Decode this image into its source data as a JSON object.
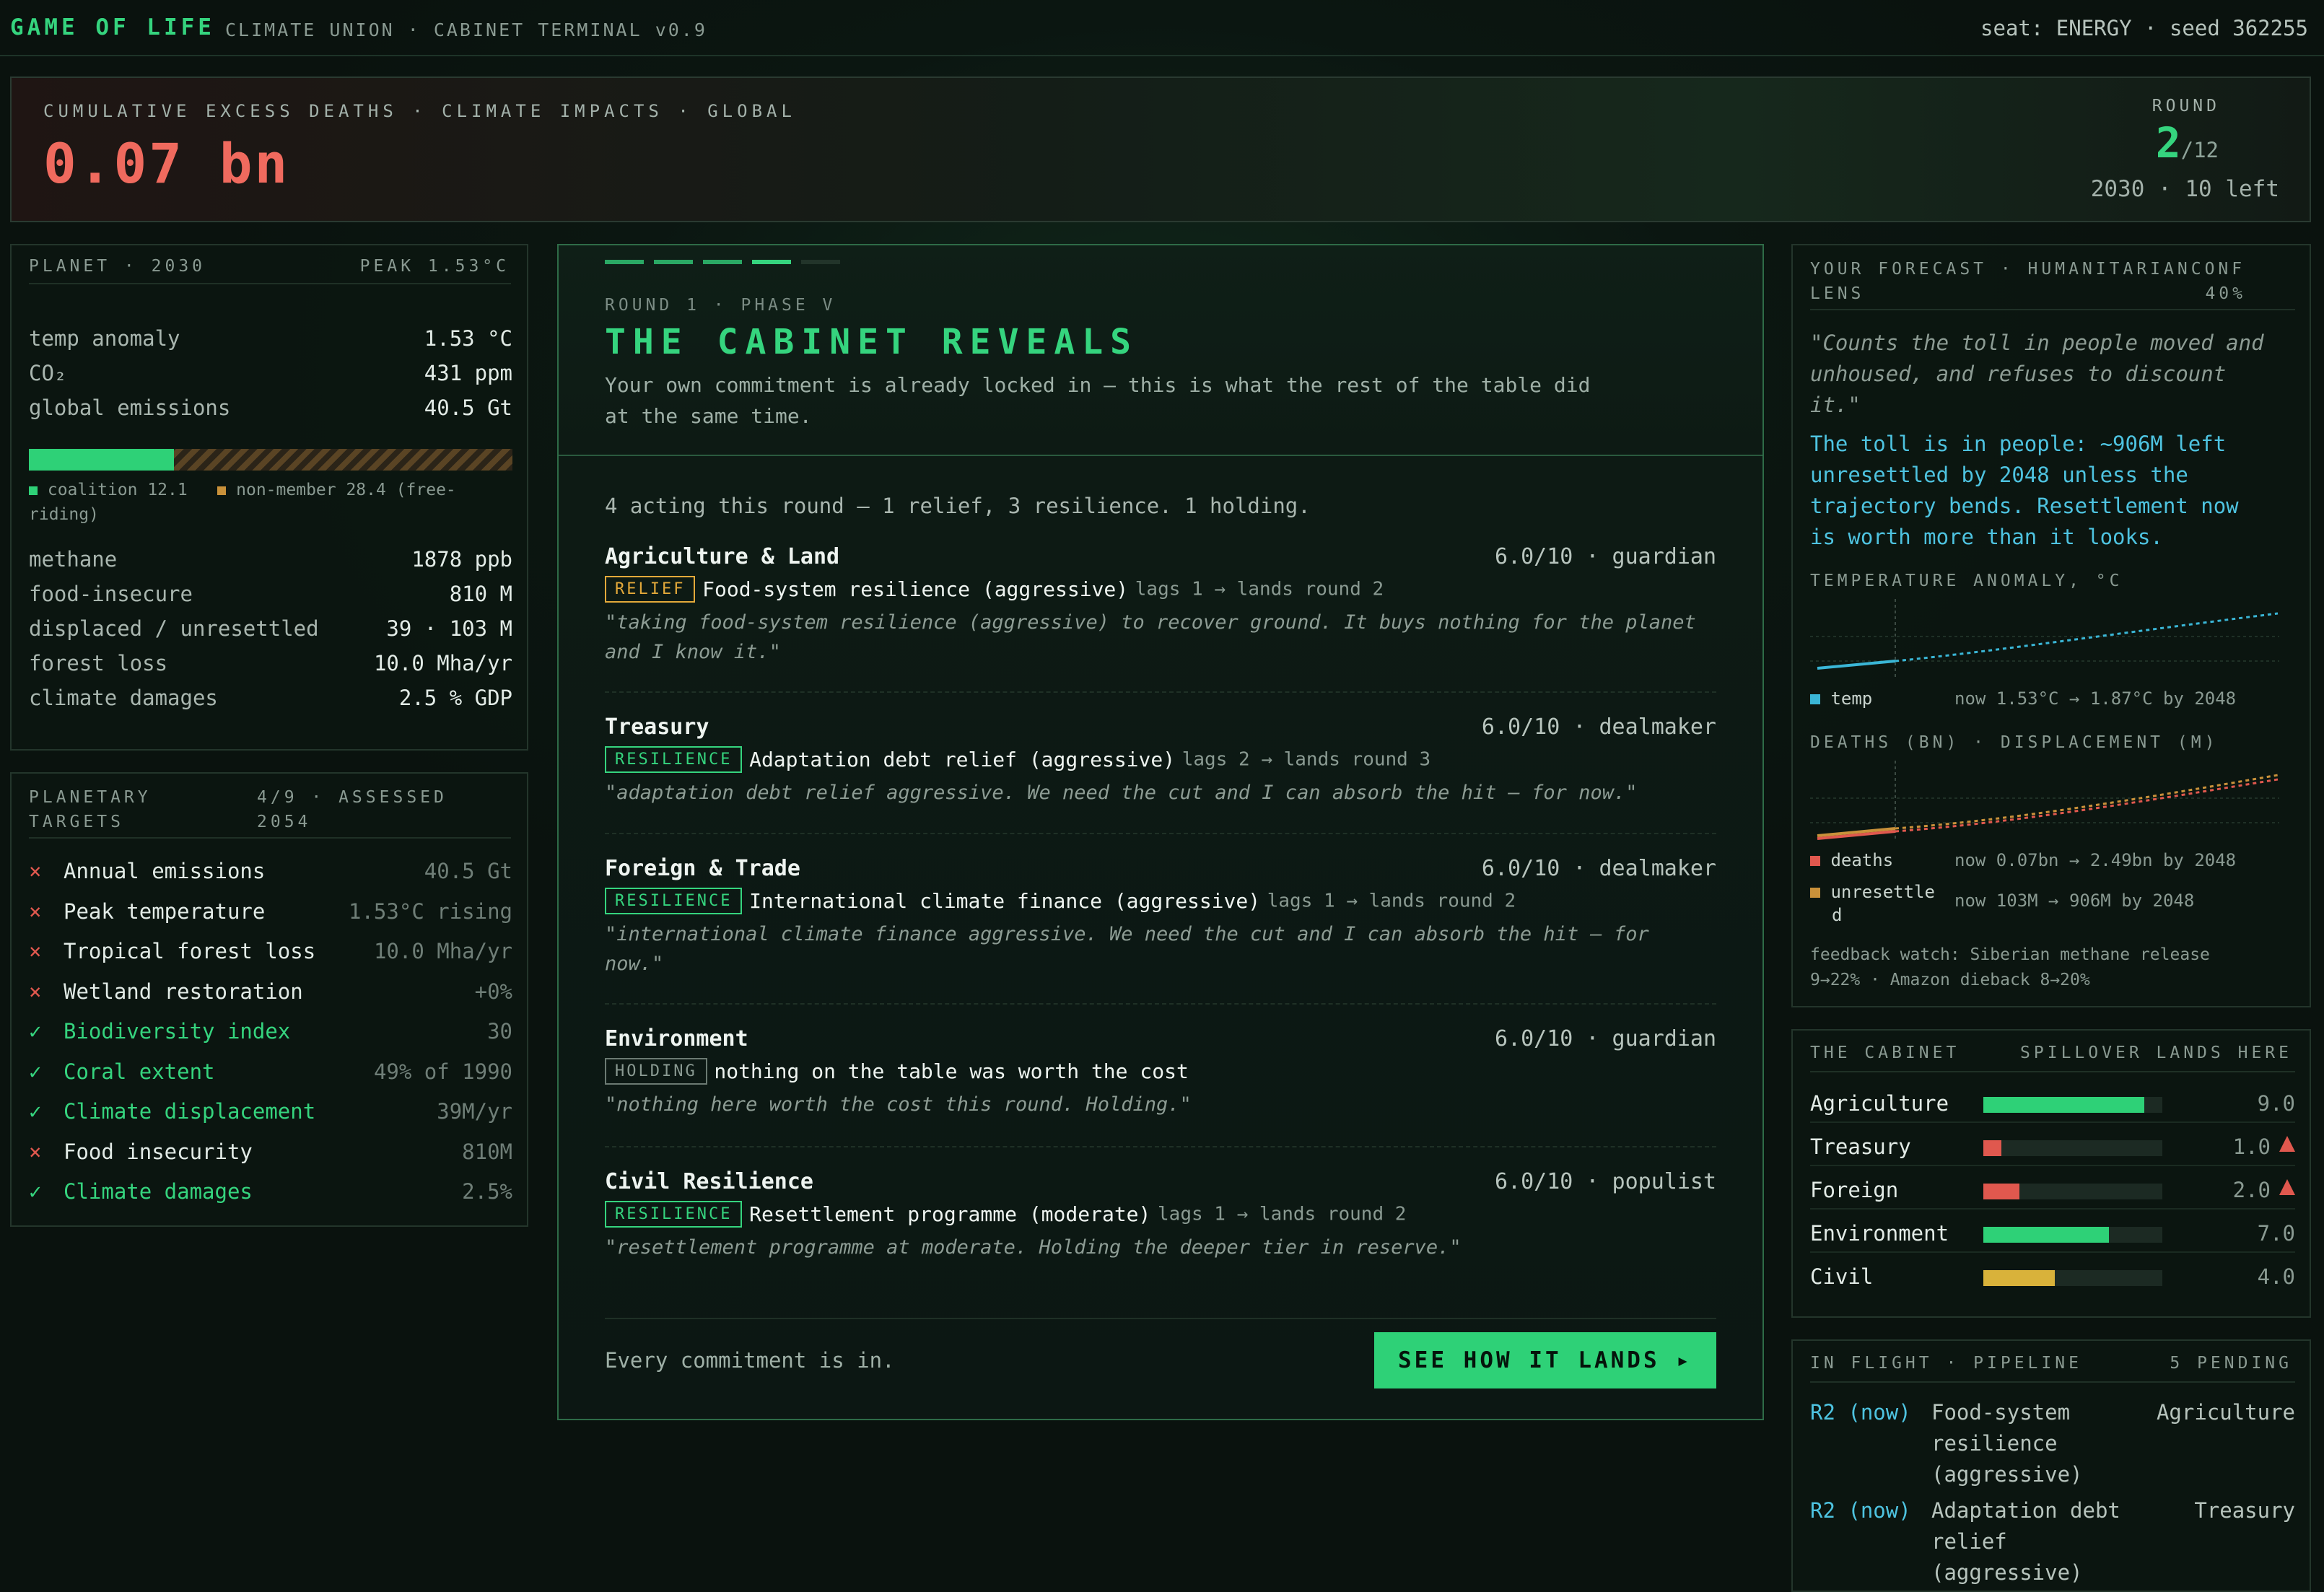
{
  "header": {
    "brand": "GAME OF LIFE",
    "subtitle": "CLIMATE UNION · CABINET TERMINAL v0.9",
    "seat": "seat: ENERGY · seed 362255"
  },
  "deaths": {
    "label": "CUMULATIVE EXCESS DEATHS · CLIMATE IMPACTS · GLOBAL",
    "value": "0.07 bn",
    "round_label": "ROUND",
    "round_value": "2",
    "round_total": "/12",
    "round_sub": "2030 · 10 left"
  },
  "planet": {
    "title": "PLANET · 2030",
    "peak": "PEAK 1.53°C",
    "stats1": [
      {
        "label": "temp anomaly",
        "value": "1.53 °C"
      },
      {
        "label": "CO₂",
        "value": "431 ppm"
      },
      {
        "label": "global emissions",
        "value": "40.5 Gt"
      }
    ],
    "coalition_share": 0.3,
    "legend_coalition": "coalition 12.1",
    "legend_nonmember": "non-member 28.4 (free-",
    "legend_wrap": "riding)",
    "stats2": [
      {
        "label": "methane",
        "value": "1878 ppb"
      },
      {
        "label": "food-insecure",
        "value": "810 M"
      },
      {
        "label": "displaced / unresettled",
        "value": "39 · 103 M"
      },
      {
        "label": "forest loss",
        "value": "10.0 Mha/yr"
      },
      {
        "label": "climate damages",
        "value": "2.5 % GDP"
      }
    ],
    "colors": {
      "coalition": "#2ed177",
      "nonmember": "#c9913a"
    }
  },
  "targets": {
    "title1": "PLANETARY",
    "title2": "TARGETS",
    "assessed1": "4/9 · ASSESSED",
    "assessed2": "2054",
    "items": [
      {
        "mark": "×",
        "label": "Annual emissions",
        "value": "40.5 Gt",
        "ok": false
      },
      {
        "mark": "×",
        "label": "Peak temperature",
        "value": "1.53°C rising",
        "ok": false
      },
      {
        "mark": "×",
        "label": "Tropical forest loss",
        "value": "10.0 Mha/yr",
        "ok": false
      },
      {
        "mark": "×",
        "label": "Wetland restoration",
        "value": "+0%",
        "ok": false
      },
      {
        "mark": "✓",
        "label": "Biodiversity index",
        "value": "30",
        "ok": true
      },
      {
        "mark": "✓",
        "label": "Coral extent",
        "value": "49% of 1990",
        "ok": true
      },
      {
        "mark": "✓",
        "label": "Climate displacement",
        "value": "39M/yr",
        "ok": true
      },
      {
        "mark": "×",
        "label": "Food insecurity",
        "value": "810M",
        "ok": false
      },
      {
        "mark": "✓",
        "label": "Climate damages",
        "value": "2.5%",
        "ok": true
      }
    ]
  },
  "cabinet": {
    "eyebrow": "ROUND 1 · PHASE V",
    "title": "THE CABINET REVEALS",
    "intro1": "Your own commitment is already locked in — this is what the rest of the table did",
    "intro2": "at the same time.",
    "summary": "4 acting this round — 1 relief, 3 resilience. 1 holding.",
    "members": [
      {
        "dept": "Agriculture & Land",
        "score": "6.0/10 · guardian",
        "tag": "RELIEF",
        "tagclass": "tg-relief",
        "action": "Food-system resilience (aggressive)",
        "lag": "lags 1 → lands round 2",
        "quote1": "\"taking food-system resilience (aggressive) to recover ground. It buys nothing for the planet",
        "quote2": "and I know it.\""
      },
      {
        "dept": "Treasury",
        "score": "6.0/10 · dealmaker",
        "tag": "RESILIENCE",
        "tagclass": "tg-res",
        "action": "Adaptation debt relief (aggressive)",
        "lag": "lags 2 → lands round 3",
        "quote1": "\"adaptation debt relief aggressive. We need the cut and I can absorb the hit — for now.\"",
        "quote2": ""
      },
      {
        "dept": "Foreign & Trade",
        "score": "6.0/10 · dealmaker",
        "tag": "RESILIENCE",
        "tagclass": "tg-res",
        "action": "International climate finance (aggressive)",
        "lag": "lags 1 → lands round 2",
        "quote1": "\"international climate finance aggressive. We need the cut and I can absorb the hit — for",
        "quote2": "now.\""
      },
      {
        "dept": "Environment",
        "score": "6.0/10 · guardian",
        "tag": "HOLDING",
        "tagclass": "tg-hold",
        "action": "nothing on the table was worth the cost",
        "lag": "",
        "quote1": "\"nothing here worth the cost this round. Holding.\"",
        "quote2": ""
      },
      {
        "dept": "Civil Resilience",
        "score": "6.0/10 · populist",
        "tag": "RESILIENCE",
        "tagclass": "tg-res",
        "action": "Resettlement programme (moderate)",
        "lag": "lags 1 → lands round 2",
        "quote1": "\"resettlement programme at moderate. Holding the deeper tier in reserve.\"",
        "quote2": ""
      }
    ],
    "footer": "Every commitment is in.",
    "button": "SEE HOW IT LANDS ▸"
  },
  "forecast": {
    "title1": "YOUR FORECAST · HUMANITARIANCONF",
    "title2": "LENS",
    "pct": "40%",
    "quote1": "\"Counts the toll in people moved and",
    "quote2": "unhoused, and refuses to discount",
    "quote3": "it.\"",
    "msg1": "The toll is in people: ~906M left",
    "msg2": "unresettled by 2048 unless the",
    "msg3": "trajectory bends. Resettlement now",
    "msg4": "is worth more than it looks.",
    "temp_label": "TEMPERATURE ANOMALY, °C",
    "temp_series": "temp",
    "temp_note": "now 1.53°C → 1.87°C by 2048",
    "deaths_label": "DEATHS (BN) · DISPLACEMENT (M)",
    "deaths_series": "deaths",
    "deaths_note": "now 0.07bn → 2.49bn by 2048",
    "unres_series1": "unresettle",
    "unres_series2": "d",
    "unres_note": "now 103M → 906M by 2048",
    "feedback1": "feedback watch: Siberian methane release",
    "feedback2": "9→22% · Amazon dieback 8→20%",
    "colors": {
      "temp": "#3ab6d6",
      "deaths": "#e0584e",
      "unres": "#c9913a"
    }
  },
  "spillover": {
    "title": "THE CABINET",
    "right": "SPILLOVER LANDS HERE",
    "rows": [
      {
        "name": "Agriculture",
        "value": "9.0",
        "level": 0.9,
        "color": "#2ed177",
        "warn": false
      },
      {
        "name": "Treasury",
        "value": "1.0",
        "level": 0.1,
        "color": "#e0584e",
        "warn": true
      },
      {
        "name": "Foreign",
        "value": "2.0",
        "level": 0.2,
        "color": "#e0584e",
        "warn": true
      },
      {
        "name": "Environment",
        "value": "7.0",
        "level": 0.7,
        "color": "#2ed177",
        "warn": false
      },
      {
        "name": "Civil",
        "value": "4.0",
        "level": 0.4,
        "color": "#d9b23a",
        "warn": false
      }
    ]
  },
  "pipeline": {
    "title": "IN FLIGHT · PIPELINE",
    "count": "5 PENDING",
    "items": [
      {
        "when": "R2 (now)",
        "l1": "Food-system",
        "l2": "resilience",
        "l3": "(aggressive)",
        "dept": "Agriculture"
      },
      {
        "when": "R2 (now)",
        "l1": "Adaptation debt",
        "l2": "relief",
        "l3": "(aggressive)",
        "dept": "Treasury"
      }
    ]
  }
}
